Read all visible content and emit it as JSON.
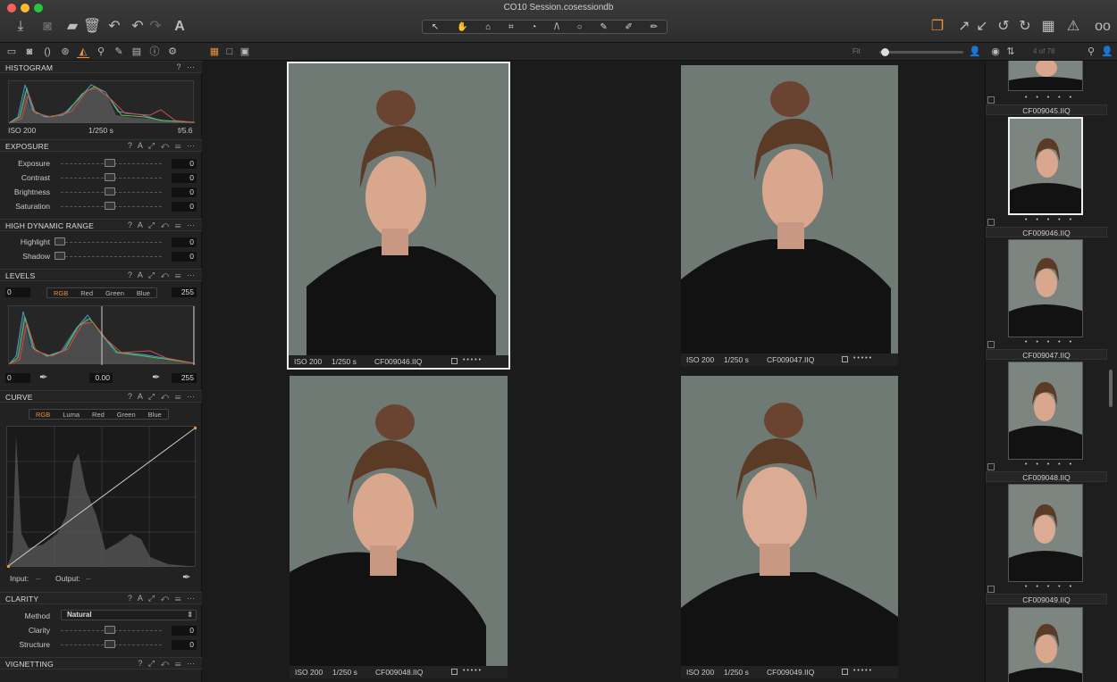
{
  "window": {
    "title": "CO10 Session.cosessiondb"
  },
  "toolbar": {
    "left_icons": [
      "import-icon",
      "camera-icon",
      "folder-move-icon",
      "trash-icon",
      "undo-alt-icon",
      "undo-icon",
      "redo-icon",
      "text-icon"
    ],
    "cursor_tools": [
      "select-cursor-icon",
      "pan-hand-icon",
      "loupe-icon",
      "crop-icon",
      "rotate-icon",
      "keystone-icon",
      "circle-mask-icon",
      "brush-icon",
      "picker-icon",
      "eraser-icon"
    ],
    "right_icons": [
      "stack-icon",
      "export-icon",
      "import-arrow-icon",
      "rotate-left-icon",
      "rotate-right-icon",
      "grid-icon",
      "warning-icon",
      "glasses-icon"
    ],
    "accent": "#e8913a"
  },
  "viewer": {
    "fit_label": "Fit",
    "count_label": "4 of 78"
  },
  "panels": {
    "histogram": {
      "title": "HISTOGRAM",
      "iso": "ISO 200",
      "shutter": "1/250 s",
      "aperture": "f/5.6"
    },
    "exposure": {
      "title": "EXPOSURE",
      "sliders": [
        {
          "label": "Exposure",
          "value": "0"
        },
        {
          "label": "Contrast",
          "value": "0"
        },
        {
          "label": "Brightness",
          "value": "0"
        },
        {
          "label": "Saturation",
          "value": "0"
        }
      ]
    },
    "hdr": {
      "title": "HIGH DYNAMIC RANGE",
      "sliders": [
        {
          "label": "Highlight",
          "value": "0"
        },
        {
          "label": "Shadow",
          "value": "0"
        }
      ]
    },
    "levels": {
      "title": "LEVELS",
      "low": "0",
      "high": "255",
      "channels": [
        "RGB",
        "Red",
        "Green",
        "Blue"
      ],
      "out_low": "0",
      "mid": "0.00",
      "out_high": "255"
    },
    "curve": {
      "title": "CURVE",
      "channels": [
        "RGB",
        "Luma",
        "Red",
        "Green",
        "Blue"
      ],
      "input_label": "Input:",
      "input_val": "--",
      "output_label": "Output:",
      "output_val": "--"
    },
    "clarity": {
      "title": "CLARITY",
      "method_label": "Method",
      "method": "Natural",
      "sliders": [
        {
          "label": "Clarity",
          "value": "0"
        },
        {
          "label": "Structure",
          "value": "0"
        }
      ]
    },
    "vignetting": {
      "title": "VIGNETTING"
    }
  },
  "photos": [
    {
      "iso": "ISO 200",
      "shutter": "1/250 s",
      "name": "CF009046.IIQ",
      "dots": "• • • • •"
    },
    {
      "iso": "ISO 200",
      "shutter": "1/250 s",
      "name": "CF009047.IIQ",
      "dots": "• • • • •"
    },
    {
      "iso": "ISO 200",
      "shutter": "1/250 s",
      "name": "CF009048.IIQ",
      "dots": "• • • • •"
    },
    {
      "iso": "ISO 200",
      "shutter": "1/250 s",
      "name": "CF009049.IIQ",
      "dots": "• • • • •"
    }
  ],
  "browser": {
    "items": [
      {
        "name": "CF009045.IIQ",
        "dots": "• • • • •"
      },
      {
        "name": "CF009046.IIQ",
        "dots": "• • • • •"
      },
      {
        "name": "CF009047.IIQ",
        "dots": "• • • • •"
      },
      {
        "name": "CF009048.IIQ",
        "dots": "• • • • •"
      },
      {
        "name": "CF009049.IIQ",
        "dots": "• • • • •"
      }
    ]
  }
}
